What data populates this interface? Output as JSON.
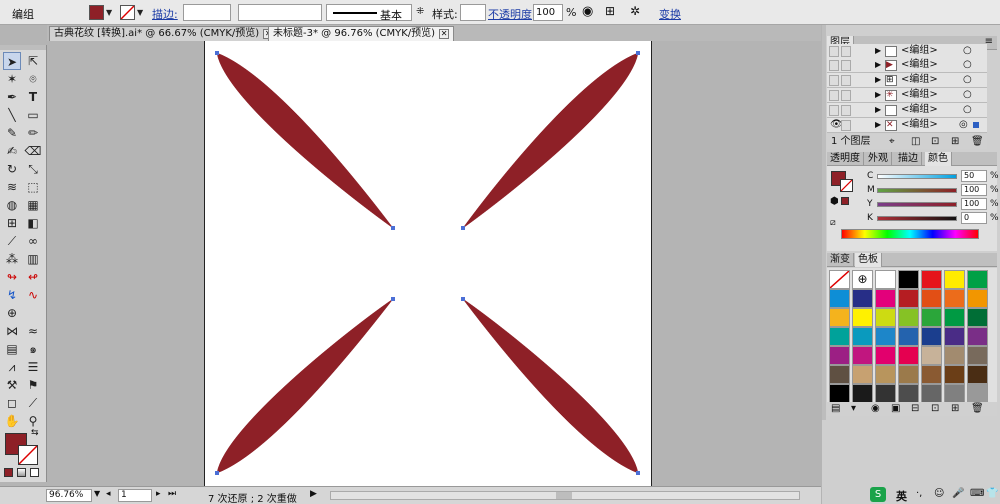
{
  "control_bar": {
    "object_type": "编组",
    "stroke_label": "描边:",
    "stroke_style_label": "基本",
    "style_label": "样式:",
    "opacity_label": "不透明度",
    "opacity_value": "100",
    "opacity_unit": "%",
    "transform_link": "变换",
    "fill_color": "#8e2027"
  },
  "doc_tabs": [
    {
      "label": "古典花纹 [转换].ai* @ 66.67% (CMYK/预览)"
    },
    {
      "label": "未标题-3* @ 96.76% (CMYK/预览)"
    }
  ],
  "layers_panel": {
    "title": "图层",
    "rows": [
      {
        "label": "<编组>"
      },
      {
        "label": "<编组>"
      },
      {
        "label": "<编组>"
      },
      {
        "label": "<编组>"
      },
      {
        "label": "<编组>"
      },
      {
        "label": "<编组>"
      }
    ],
    "footer_count": "1 个图层"
  },
  "color_panel": {
    "tabs": [
      "透明度",
      "外观",
      "描边",
      "颜色"
    ],
    "channels": [
      {
        "name": "C",
        "value": "50",
        "unit": "%",
        "color": "#00a0e0"
      },
      {
        "name": "M",
        "value": "100",
        "unit": "%",
        "color": "#d4006f"
      },
      {
        "name": "Y",
        "value": "100",
        "unit": "%",
        "color": "#ffe600"
      },
      {
        "name": "K",
        "value": "0",
        "unit": "%",
        "color": "#222222"
      }
    ]
  },
  "swatches_panel": {
    "tabs": [
      "渐变",
      "色板"
    ],
    "swatches": [
      "#ffffff",
      "#ffffff",
      "#ffffff",
      "#000000",
      "#e5141b",
      "#ffeb00",
      "#00a046",
      "#0e8ed6",
      "#272e87",
      "#e3007b",
      "#b51d22",
      "#e24f15",
      "#ec6c1b",
      "#f29600",
      "#f4b31d",
      "#fff100",
      "#cddb12",
      "#86c225",
      "#2ba63a",
      "#009a43",
      "#006e36",
      "#00a29a",
      "#0a9abe",
      "#1d86c9",
      "#2463ae",
      "#1b3e8e",
      "#4a2c86",
      "#7a2e87",
      "#9c1f84",
      "#c1167f",
      "#e2006d",
      "#e50050",
      "#c7b299",
      "#a28b6f",
      "#786a5c",
      "#5f5042",
      "#c7a171",
      "#b8955d",
      "#9b7a4b",
      "#8a5a32",
      "#6b3e17",
      "#4a2d14",
      "#000000",
      "#1a1a1a",
      "#333333",
      "#4d4d4d",
      "#666666",
      "#808080",
      "#999999"
    ]
  },
  "status_bar": {
    "zoom": "96.76%",
    "page": "1",
    "history": "7 次还原 ; 2 次重做"
  },
  "artwork": {
    "fill_color": "#8e2027",
    "anchor_color": "#4b6fd6"
  },
  "system_tray": {
    "ime": "英"
  }
}
